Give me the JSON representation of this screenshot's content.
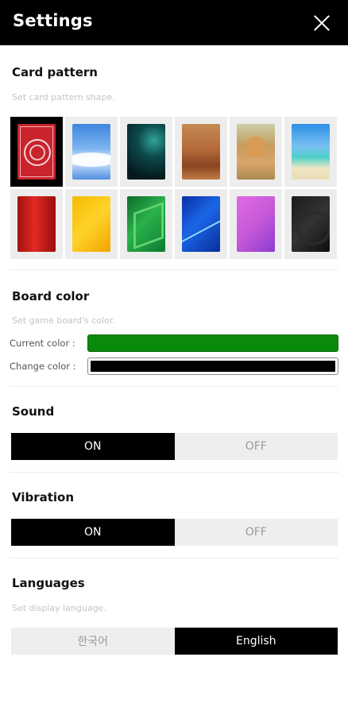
{
  "header": {
    "title": "Settings",
    "close_icon": "close-icon"
  },
  "card_pattern": {
    "title": "Card pattern",
    "description": "Set card pattern shape.",
    "selected_index": 0,
    "patterns": [
      {
        "name": "red-classic-pattern"
      },
      {
        "name": "sky-clouds-pattern"
      },
      {
        "name": "green-space-pattern"
      },
      {
        "name": "desert-dunes-pattern"
      },
      {
        "name": "puppy-pattern"
      },
      {
        "name": "tropical-beach-pattern"
      },
      {
        "name": "red-stripes-pattern"
      },
      {
        "name": "yellow-abstract-pattern"
      },
      {
        "name": "green-geometric-pattern"
      },
      {
        "name": "blue-light-pattern"
      },
      {
        "name": "violet-abstract-pattern"
      },
      {
        "name": "black-abstract-pattern"
      }
    ]
  },
  "board_color": {
    "title": "Board color",
    "description": "Set game board's color.",
    "current_label": "Current color :",
    "change_label": "Change color :",
    "current_color": "#0a8a0a",
    "change_color": "#000000"
  },
  "sound": {
    "title": "Sound",
    "on_label": "ON",
    "off_label": "OFF",
    "value": "ON"
  },
  "vibration": {
    "title": "Vibration",
    "on_label": "ON",
    "off_label": "OFF",
    "value": "ON"
  },
  "languages": {
    "title": "Languages",
    "description": "Set display language.",
    "options": [
      "한국어",
      "English"
    ],
    "selected": "English"
  },
  "colors": {
    "header_bg": "#000000",
    "active_bg": "#000000",
    "inactive_bg": "#eeeeee"
  }
}
